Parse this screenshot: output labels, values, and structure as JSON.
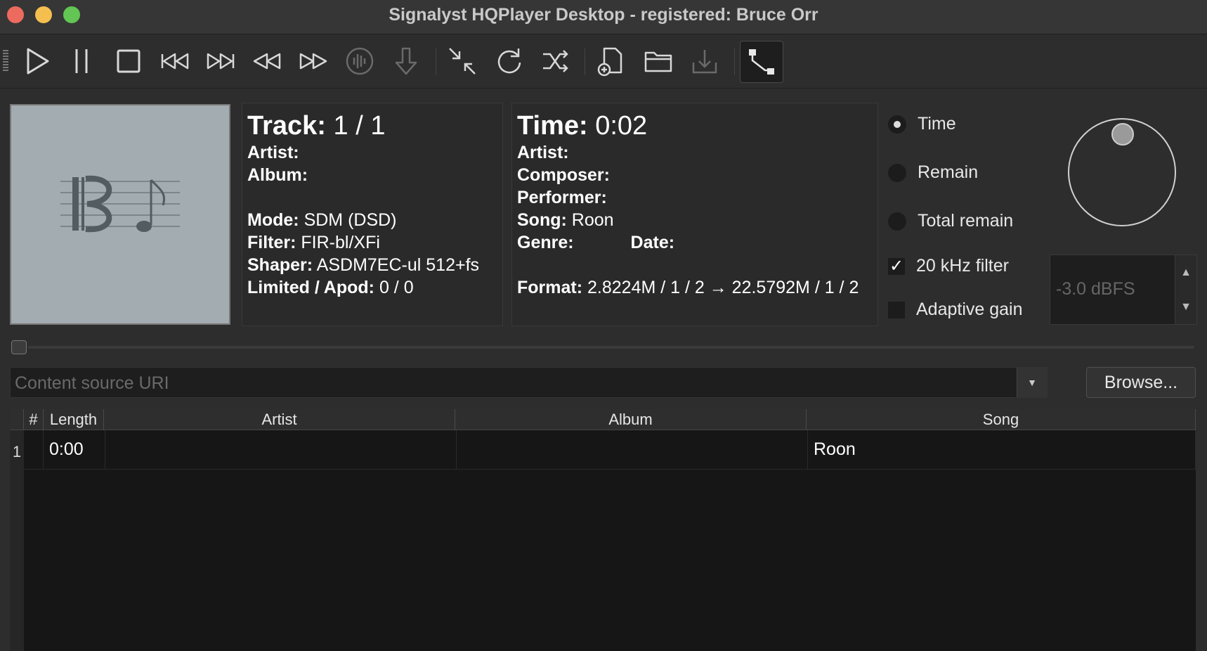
{
  "window": {
    "title": "Signalyst HQPlayer Desktop - registered: Bruce Orr"
  },
  "toolbar": {
    "icons": [
      "play-icon",
      "pause-icon",
      "stop-icon",
      "previous-track-icon",
      "next-track-icon",
      "rewind-icon",
      "fast-forward-icon",
      "transport-icon",
      "download-arrow-icon",
      "collapse-icon",
      "repeat-icon",
      "shuffle-icon",
      "add-file-icon",
      "open-folder-icon",
      "import-icon",
      "matrix-routing-icon"
    ]
  },
  "track_info": {
    "track_label": "Track:",
    "track_value": "1 / 1",
    "artist_label": "Artist:",
    "artist_value": "",
    "album_label": "Album:",
    "album_value": "",
    "mode_label": "Mode:",
    "mode_value": "SDM (DSD)",
    "filter_label": "Filter:",
    "filter_value": "FIR-bl/XFi",
    "shaper_label": "Shaper:",
    "shaper_value": "ASDM7EC-ul 512+fs",
    "limited_label": "Limited / Apod:",
    "limited_value": "0 / 0"
  },
  "time_info": {
    "time_label": "Time:",
    "time_value": "0:02",
    "artist_label": "Artist:",
    "artist_value": "",
    "composer_label": "Composer:",
    "composer_value": "",
    "performer_label": "Performer:",
    "performer_value": "",
    "song_label": "Song:",
    "song_value": "Roon",
    "genre_label": "Genre:",
    "genre_value": "",
    "date_label": "Date:",
    "date_value": "",
    "format_label": "Format:",
    "format_value": "2.8224M / 1 / 2 → 22.5792M / 1 / 2"
  },
  "time_mode": {
    "options": [
      "Time",
      "Remain",
      "Total remain"
    ],
    "selected": "Time"
  },
  "checkboxes": {
    "filter_20k_label": "20 kHz filter",
    "filter_20k_checked": true,
    "adaptive_gain_label": "Adaptive gain",
    "adaptive_gain_checked": false,
    "check_glyph": "✓"
  },
  "volume": {
    "value": "-3.0 dBFS",
    "up_glyph": "▲",
    "down_glyph": "▼"
  },
  "seek": {
    "position": 0.0
  },
  "source": {
    "placeholder": "Content source URI",
    "dropdown_glyph": "▼",
    "browse_label": "Browse..."
  },
  "playlist": {
    "columns": [
      "#",
      "Length",
      "Artist",
      "Album",
      "Song"
    ],
    "rows": [
      {
        "num": "1",
        "length": "0:00",
        "artist": "",
        "album": "",
        "song": "Roon"
      }
    ]
  }
}
